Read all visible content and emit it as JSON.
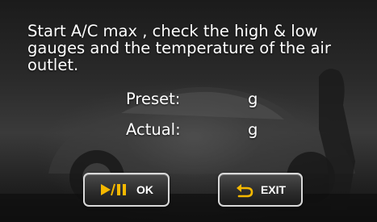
{
  "message": {
    "line1": "Start A/C max , check the high & low",
    "line2": "gauges and the temperature of the air",
    "line3": "outlet."
  },
  "readings": {
    "preset_label": "Preset:",
    "preset_unit": "g",
    "actual_label": "Actual:",
    "actual_unit": "g"
  },
  "buttons": {
    "ok_label": "OK",
    "exit_label": "EXIT"
  },
  "icons": {
    "ok_icon": "play-pause-icon",
    "exit_icon": "return-arrow-icon"
  },
  "colors": {
    "icon_accent": "#f5b800",
    "text": "#ffffff"
  }
}
